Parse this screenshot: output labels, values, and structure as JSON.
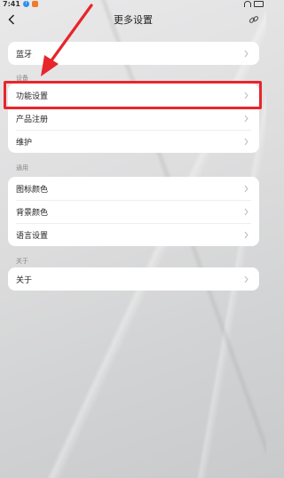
{
  "status_bar": {
    "time": "7:41",
    "info_badge": "i"
  },
  "header": {
    "title": "更多设置"
  },
  "groups": [
    {
      "heading": "",
      "items": [
        {
          "label": "蓝牙"
        }
      ]
    },
    {
      "heading": "设备",
      "items": [
        {
          "label": "功能设置"
        },
        {
          "label": "产品注册"
        },
        {
          "label": "维护"
        }
      ]
    },
    {
      "heading": "通用",
      "items": [
        {
          "label": "图标颜色"
        },
        {
          "label": "背景颜色"
        },
        {
          "label": "语言设置"
        }
      ]
    },
    {
      "heading": "关于",
      "items": [
        {
          "label": "关于"
        }
      ]
    }
  ],
  "icons": {
    "back": "back-arrow-icon",
    "action": "link-icon",
    "chevron": "chevron-right-icon"
  },
  "annotation": {
    "highlight_color": "#e8252b",
    "highlighted_item": "功能设置"
  }
}
